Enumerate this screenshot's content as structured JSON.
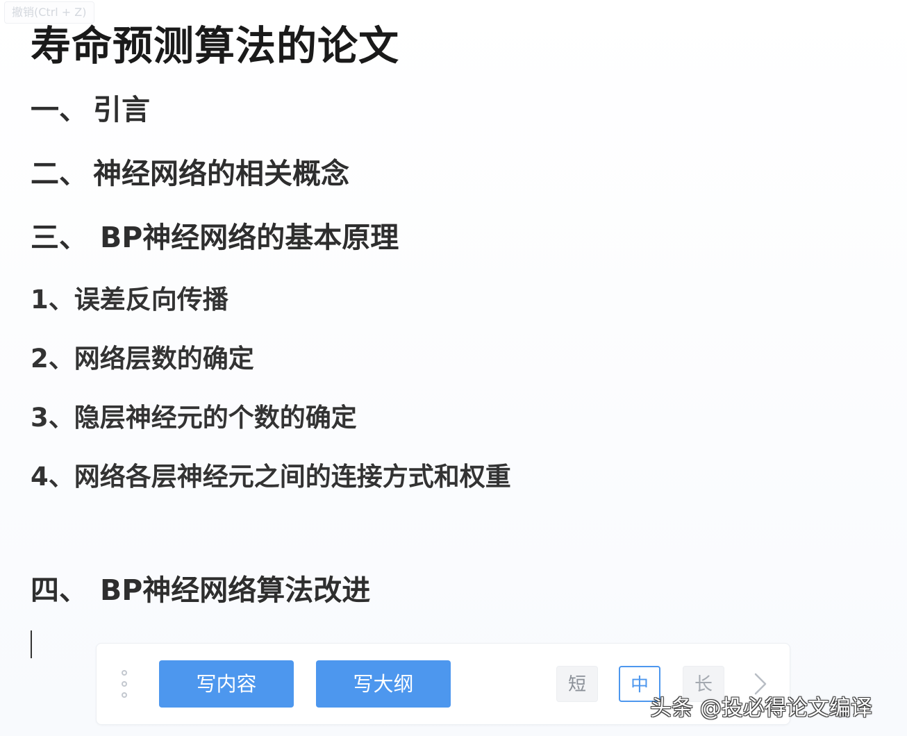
{
  "undo_tooltip": "撤销(Ctrl + Z)",
  "document": {
    "title": "寿命预测算法的论文",
    "sections": [
      {
        "num": "一、",
        "text": "引言"
      },
      {
        "num": "二、",
        "text": "神经网络的相关概念"
      },
      {
        "num": "三、",
        "text": "BP神经网络的基本原理"
      },
      {
        "num": "四、",
        "text": "BP神经网络算法改进"
      }
    ],
    "subitems": [
      "1、误差反向传播",
      "2、网络层数的确定",
      "3、隐层神经元的个数的确定",
      "4、网络各层神经元之间的连接方式和权重"
    ]
  },
  "toolbar": {
    "handle_icon": "drag-handle-icon",
    "write_content_label": "写内容",
    "write_outline_label": "写大纲",
    "length_options": [
      "短",
      "中",
      "长"
    ],
    "selected_length": "中",
    "next_icon": "chevron-right-icon"
  },
  "colors": {
    "accent": "#4d97ee",
    "text_dark": "#1a1a1a",
    "text_body": "#333333"
  },
  "watermark": "头条 @投必得论文编译"
}
